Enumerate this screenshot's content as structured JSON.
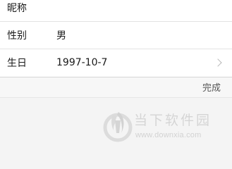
{
  "form": {
    "rows": [
      {
        "label": "昵称",
        "value": ""
      },
      {
        "label": "性别",
        "value": "男"
      },
      {
        "label": "生日",
        "value": "1997-10-7"
      }
    ]
  },
  "toolbar": {
    "done_label": "完成"
  },
  "watermark": {
    "brand": "当下软件园",
    "url": "www.downxia.com",
    "logo_icon": "downxia-logo-icon"
  },
  "colors": {
    "text": "#1a1a1a",
    "background": "#f4f4f4",
    "divider": "#e3e3e3",
    "chevron": "#b9b9b9",
    "done_text": "#555555"
  }
}
